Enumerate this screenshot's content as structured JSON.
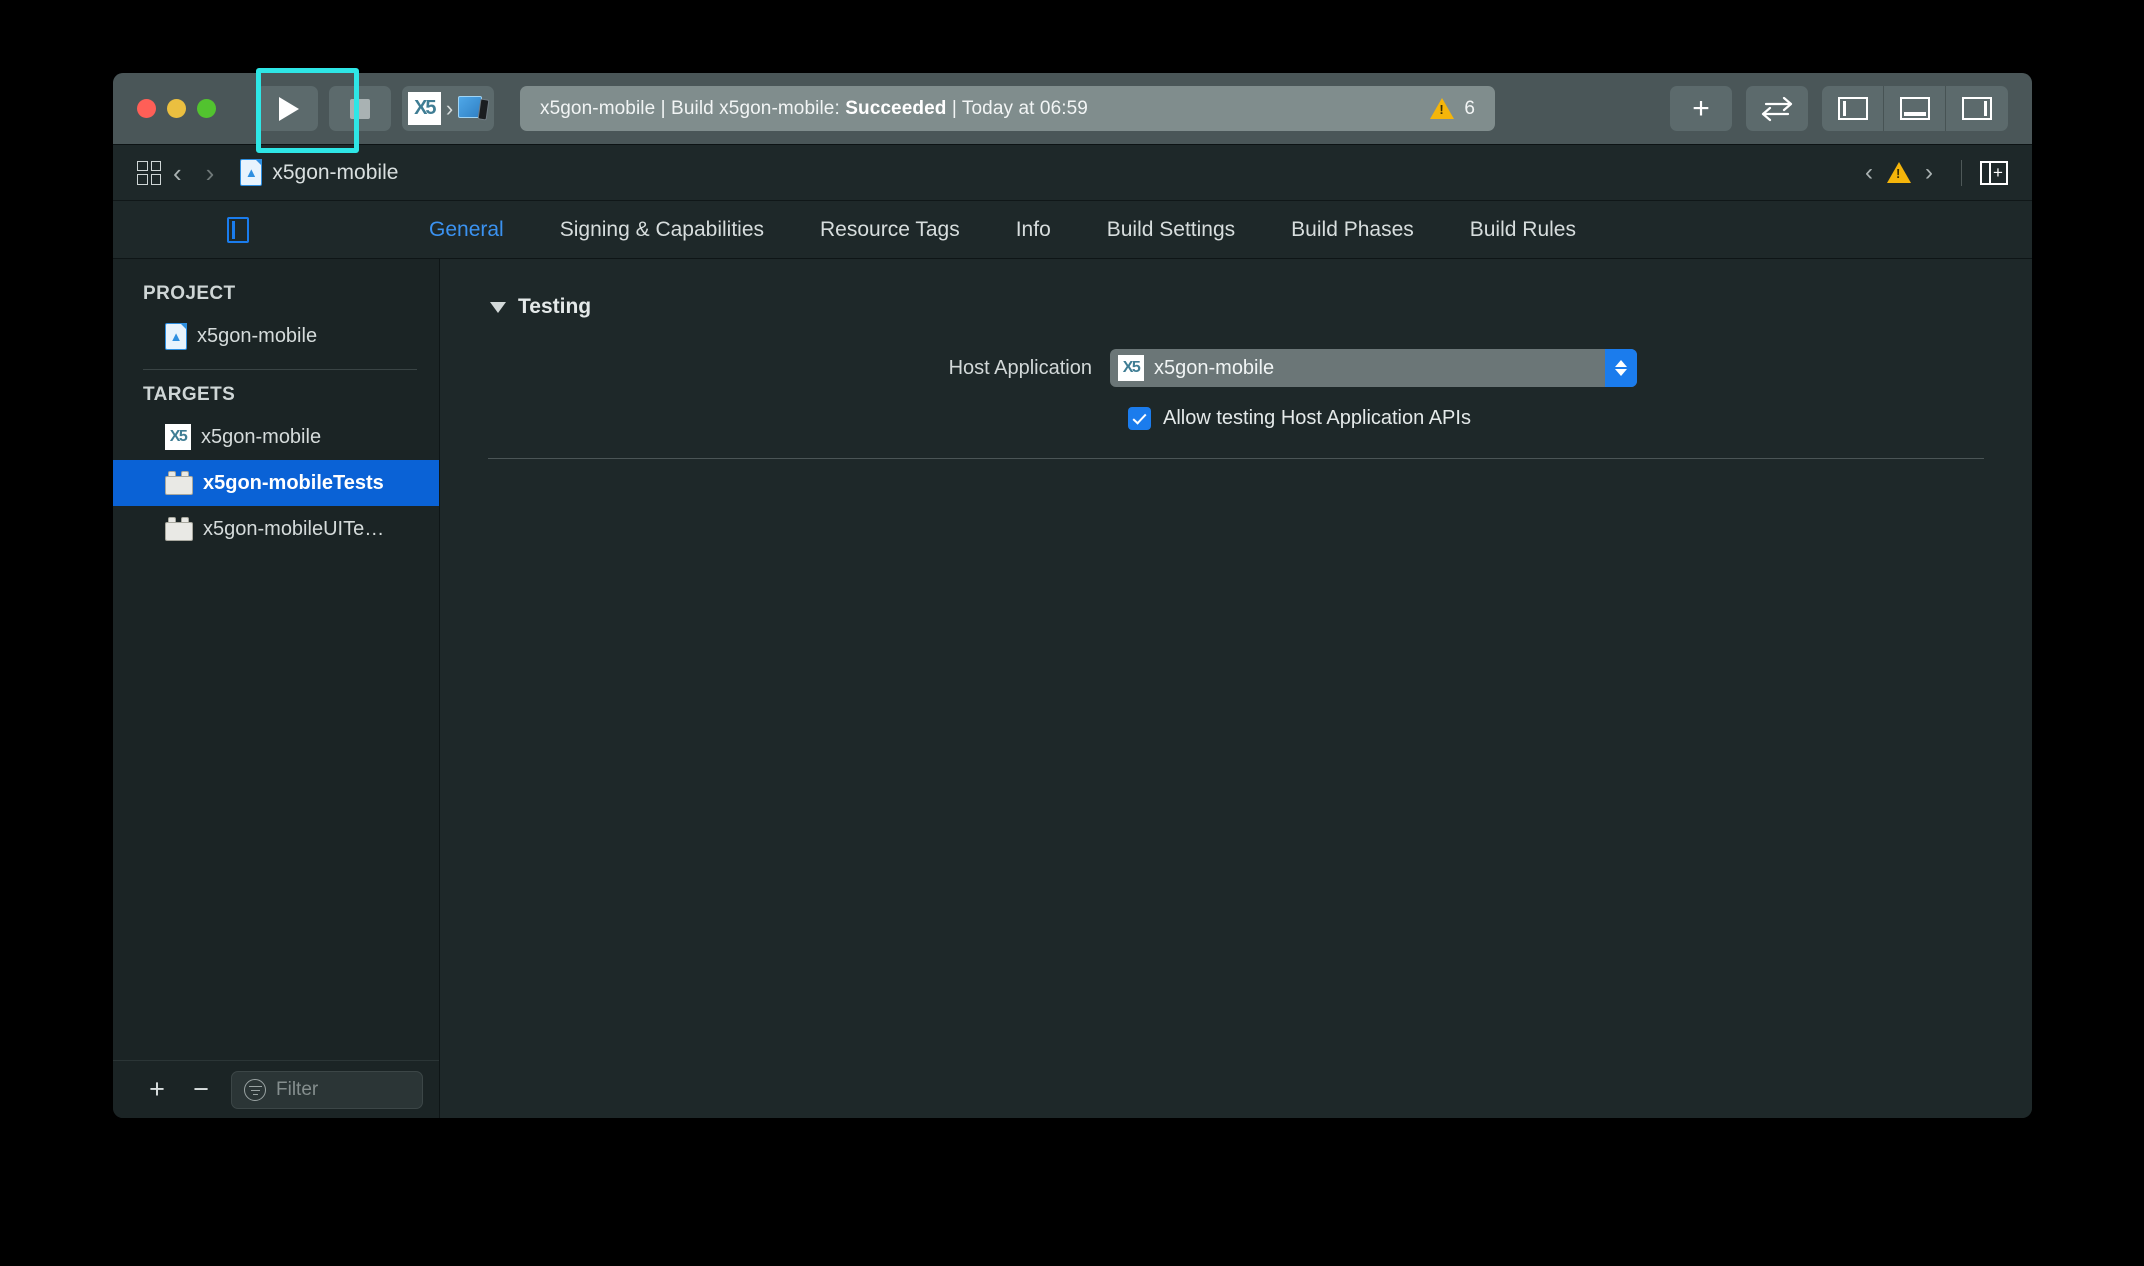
{
  "window": {
    "traffic_lights": [
      "close",
      "minimize",
      "maximize"
    ]
  },
  "toolbar": {
    "run_label": "run-scheme",
    "stop_label": "stop-scheme",
    "scheme_name": "x5gon-mobile",
    "scheme_destination": "iOS Simulator",
    "status": {
      "project": "x5gon-mobile",
      "action": "Build x5gon-mobile:",
      "result": "Succeeded",
      "time": "Today at 06:59",
      "full_text_prefix": "x5gon-mobile | Build x5gon-mobile: ",
      "full_text_suffix": " | Today at 06:59",
      "warning_count": "6"
    },
    "add_label": "+",
    "swap_icon": "swap-arrows-icon",
    "layout_buttons": [
      "navigator-pane-toggle",
      "debug-pane-toggle",
      "inspector-pane-toggle"
    ]
  },
  "nav_bar": {
    "grid_icon": "grid-view-icon",
    "back": "‹",
    "forward": "›",
    "breadcrumb_item": "x5gon-mobile",
    "issue_prev": "‹",
    "issue_next": "›",
    "warning_icon": "warning-triangle-icon",
    "split_icon": "add-editor-icon"
  },
  "tabs": {
    "items": [
      {
        "label": "General",
        "active": true
      },
      {
        "label": "Signing & Capabilities",
        "active": false
      },
      {
        "label": "Resource Tags",
        "active": false
      },
      {
        "label": "Info",
        "active": false
      },
      {
        "label": "Build Settings",
        "active": false
      },
      {
        "label": "Build Phases",
        "active": false
      },
      {
        "label": "Build Rules",
        "active": false
      }
    ]
  },
  "sidebar": {
    "project_header": "PROJECT",
    "project_items": [
      {
        "label": "x5gon-mobile",
        "icon": "xcode-project-icon",
        "selected": false
      }
    ],
    "targets_header": "TARGETS",
    "target_items": [
      {
        "label": "x5gon-mobile",
        "icon": "app-target-icon",
        "selected": false
      },
      {
        "label": "x5gon-mobileTests",
        "icon": "test-bundle-icon",
        "selected": true
      },
      {
        "label": "x5gon-mobileUITe…",
        "icon": "test-bundle-icon",
        "selected": false
      }
    ],
    "footer": {
      "add_label": "+",
      "remove_label": "−",
      "filter_placeholder": "Filter"
    }
  },
  "content": {
    "section_title": "Testing",
    "section_expanded": true,
    "host_application": {
      "label": "Host Application",
      "value": "x5gon-mobile",
      "icon": "app-target-icon"
    },
    "allow_testing": {
      "label": "Allow testing Host Application APIs",
      "checked": true
    }
  },
  "colors": {
    "toolbar_bg": "#4a5658",
    "window_bg": "#1e2829",
    "sidebar_bg": "#1b2425",
    "selection_blue": "#0a62d6",
    "accent_blue": "#1b7ced",
    "tab_active": "#3b92f0",
    "warning_yellow": "#f5b50a",
    "highlight_cyan": "#2ee6e6",
    "status_bg": "#808d8d"
  }
}
